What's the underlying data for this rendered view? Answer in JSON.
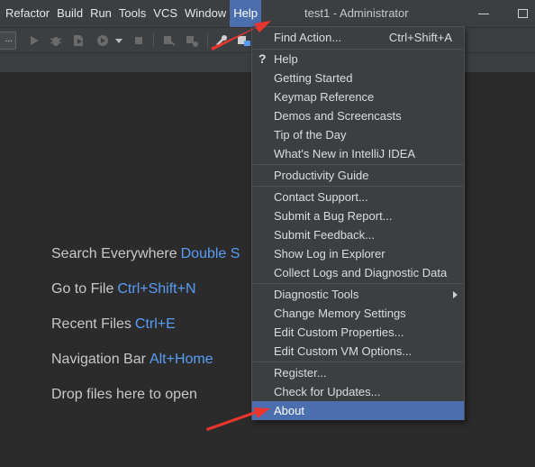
{
  "menubar": {
    "items": [
      "Refactor",
      "Build",
      "Run",
      "Tools",
      "VCS",
      "Window",
      "Help"
    ],
    "active": "Help"
  },
  "window_title": "test1 - Administrator",
  "toolbar": {
    "run_config_label": "..."
  },
  "welcome": [
    {
      "label": "Search Everywhere",
      "key": "Double S"
    },
    {
      "label": "Go to File",
      "key": "Ctrl+Shift+N"
    },
    {
      "label": "Recent Files",
      "key": "Ctrl+E"
    },
    {
      "label": "Navigation Bar",
      "key": "Alt+Home"
    },
    {
      "label": "Drop files here to open",
      "key": ""
    }
  ],
  "help_menu": {
    "find_action": {
      "label": "Find Action...",
      "shortcut": "Ctrl+Shift+A"
    },
    "help": "Help",
    "getting_started": "Getting Started",
    "keymap_reference": "Keymap Reference",
    "demos": "Demos and Screencasts",
    "tip_of_day": "Tip of the Day",
    "whats_new": "What's New in IntelliJ IDEA",
    "productivity_guide": "Productivity Guide",
    "contact_support": "Contact Support...",
    "submit_bug": "Submit a Bug Report...",
    "submit_feedback": "Submit Feedback...",
    "show_log": "Show Log in Explorer",
    "collect_logs": "Collect Logs and Diagnostic Data",
    "diagnostic_tools": "Diagnostic Tools",
    "change_memory": "Change Memory Settings",
    "edit_properties": "Edit Custom Properties...",
    "edit_vm_options": "Edit Custom VM Options...",
    "register": "Register...",
    "check_updates": "Check for Updates...",
    "about": "About",
    "selected": "About"
  },
  "colors": {
    "background": "#2b2b2b",
    "panel": "#3c3f41",
    "selection": "#4b6eaf",
    "shortcut_blue": "#589df6",
    "annotation_red": "#e8352e"
  }
}
